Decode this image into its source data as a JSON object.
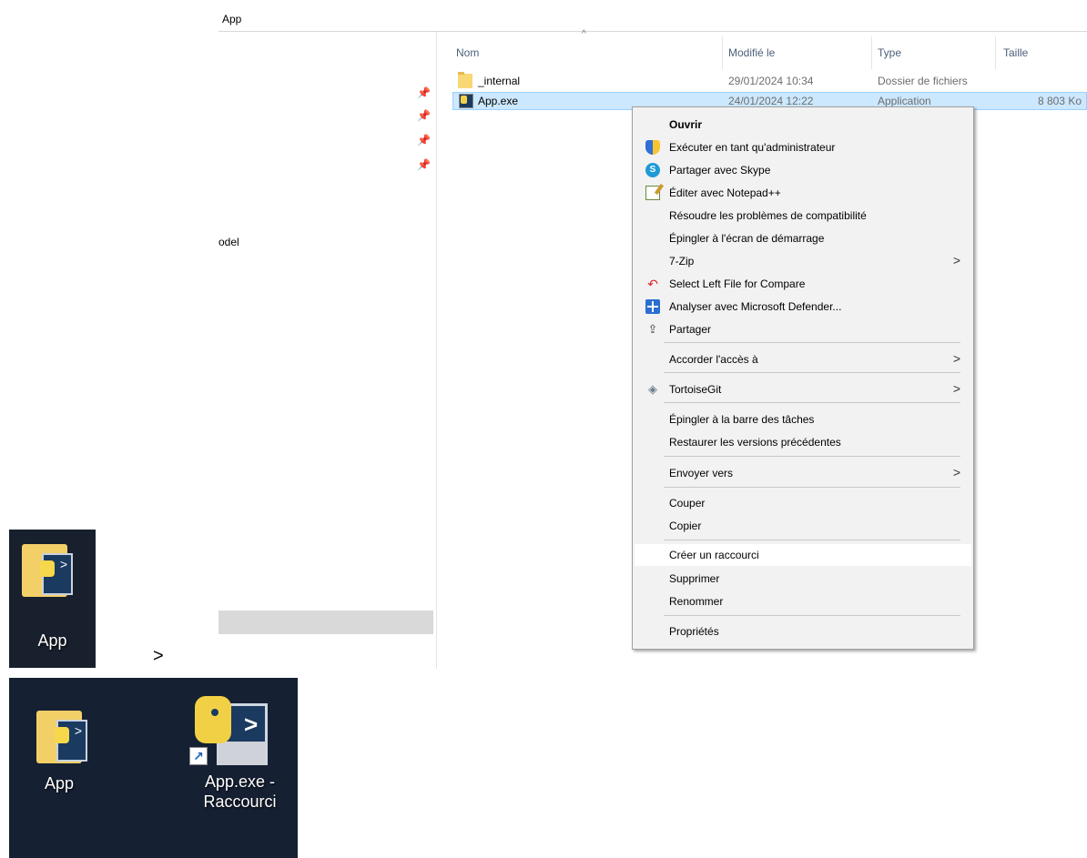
{
  "explorer": {
    "address": "App",
    "left_pane_text": "odel",
    "columns": {
      "name": "Nom",
      "modified": "Modifié le",
      "type": "Type",
      "size": "Taille"
    },
    "files": [
      {
        "name": "_internal",
        "modified": "29/01/2024 10:34",
        "type": "Dossier de fichiers",
        "size": "",
        "icon": "folder-icon"
      },
      {
        "name": "App.exe",
        "modified": "24/01/2024 12:22",
        "type": "Application",
        "size": "8 803 Ko",
        "icon": "app-exe-icon"
      }
    ]
  },
  "context_menu": {
    "items": [
      {
        "label": "Ouvrir",
        "icon": "",
        "bold": true
      },
      {
        "label": "Exécuter en tant qu'administrateur",
        "icon": "uac-shield-icon"
      },
      {
        "label": "Partager avec Skype",
        "icon": "skype-icon"
      },
      {
        "label": "Éditer avec Notepad++",
        "icon": "notepad-icon"
      },
      {
        "label": "Résoudre les problèmes de compatibilité",
        "icon": ""
      },
      {
        "label": "Épingler à l'écran de démarrage",
        "icon": ""
      },
      {
        "label": "7-Zip",
        "icon": "",
        "submenu": true
      },
      {
        "label": "Select Left File for Compare",
        "icon": "compare-icon"
      },
      {
        "label": "Analyser avec Microsoft Defender...",
        "icon": "defender-icon"
      },
      {
        "label": "Partager",
        "icon": "share-icon"
      },
      {
        "label": "Accorder l'accès à",
        "icon": "",
        "submenu": true
      },
      {
        "label": "TortoiseGit",
        "icon": "tortoisegit-icon",
        "submenu": true
      },
      {
        "label": "Épingler à la barre des tâches",
        "icon": ""
      },
      {
        "label": "Restaurer les versions précédentes",
        "icon": ""
      },
      {
        "label": "Envoyer vers",
        "icon": "",
        "submenu": true
      },
      {
        "label": "Couper",
        "icon": ""
      },
      {
        "label": "Copier",
        "icon": ""
      },
      {
        "label": "Créer un raccourci",
        "icon": "",
        "highlighted": true
      },
      {
        "label": "Supprimer",
        "icon": ""
      },
      {
        "label": "Renommer",
        "icon": ""
      },
      {
        "label": "Propriétés",
        "icon": ""
      }
    ]
  },
  "arrow_text": ">",
  "desktop_before": {
    "icons": [
      {
        "label": "App"
      }
    ]
  },
  "desktop_after": {
    "icons": [
      {
        "label": "App"
      },
      {
        "label_line1": "App.exe -",
        "label_line2": "Raccourci"
      }
    ]
  }
}
